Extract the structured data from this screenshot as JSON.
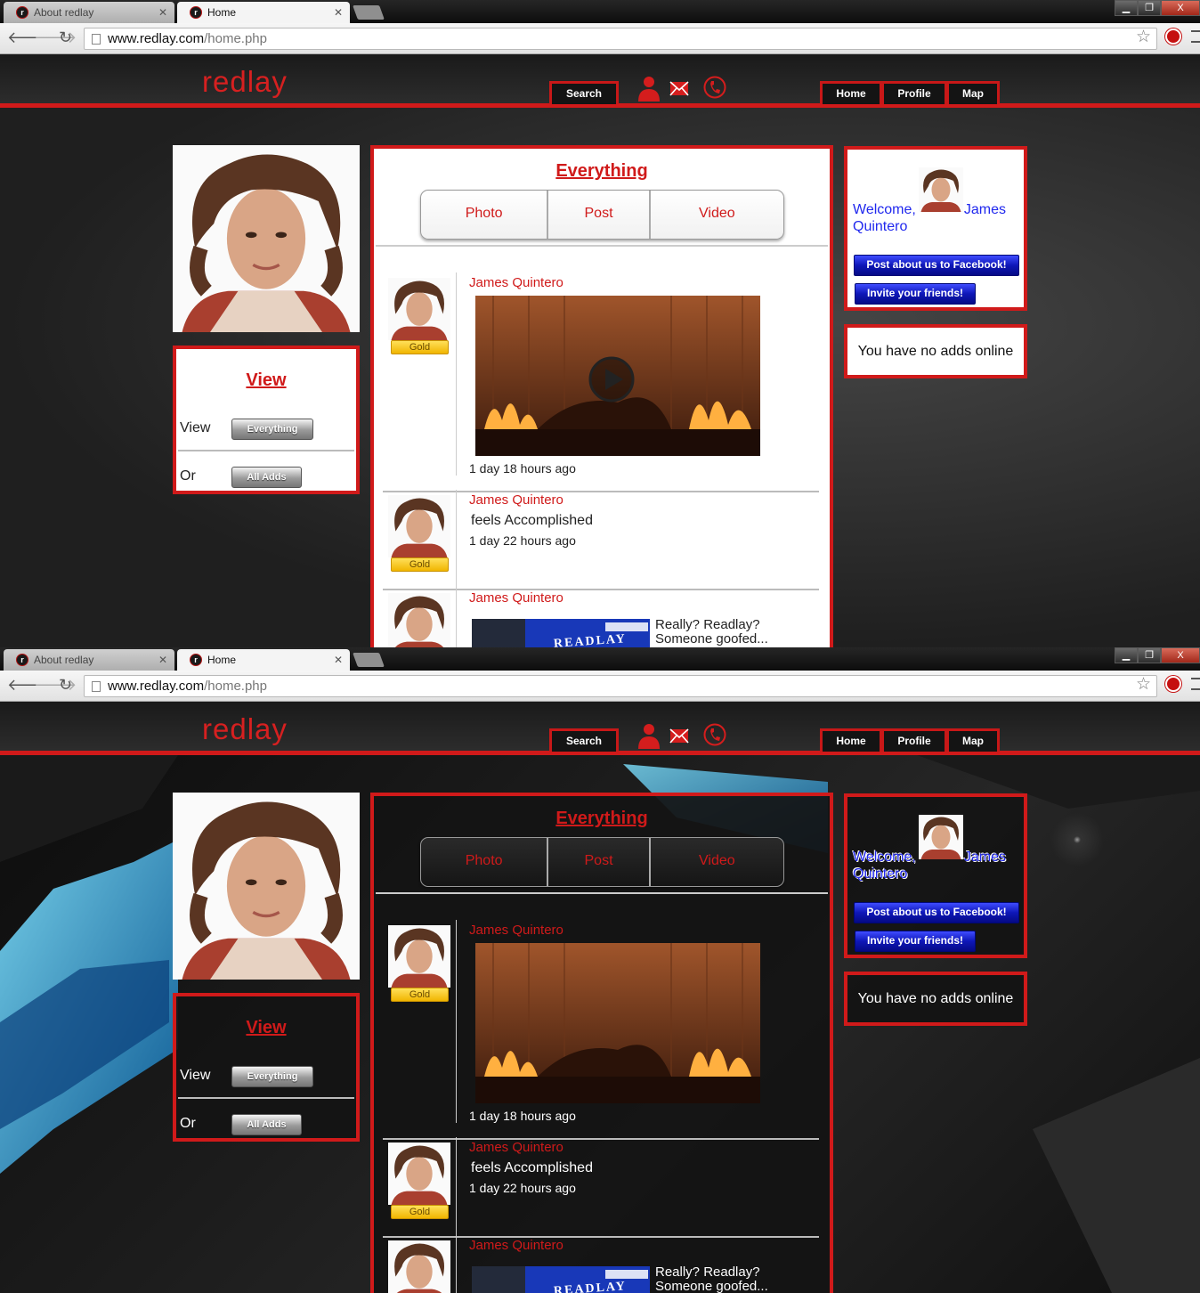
{
  "browser": {
    "tabs": [
      {
        "label": "About redlay"
      },
      {
        "label": "Home"
      }
    ],
    "url_domain": "www.redlay.com",
    "url_path": "/home.php",
    "window_close": "X"
  },
  "site": {
    "logo": "redlay",
    "search_label": "Search",
    "nav": [
      "Home",
      "Profile",
      "Map"
    ],
    "icons": [
      "person-icon",
      "mail-icon",
      "phone-icon"
    ]
  },
  "view_panel": {
    "title": "View",
    "view_label": "View",
    "view_button": "Everything",
    "or_label": "Or",
    "or_button": "All Adds"
  },
  "feed": {
    "title": "Everything",
    "filters": [
      "Photo",
      "Post",
      "Video"
    ],
    "posts": [
      {
        "author": "James Quintero",
        "badge": "Gold",
        "type": "video",
        "time": "1 day 18 hours ago"
      },
      {
        "author": "James Quintero",
        "badge": "Gold",
        "type": "status",
        "text": "feels Accomplished",
        "time": "1 day 22 hours ago"
      },
      {
        "author": "James Quintero",
        "badge": "Gold",
        "type": "link",
        "thumb_text": "READLAY",
        "text_line1": "Really? Readlay?",
        "text_line2": "Someone goofed..."
      }
    ]
  },
  "welcome": {
    "text_before": "Welcome,",
    "name_part1": "James",
    "name_part2": "Quintero",
    "facebook_button": "Post about us to Facebook!",
    "invite_button": "Invite your friends!"
  },
  "ads": {
    "message": "You have no adds online"
  },
  "colors": {
    "accent": "#d01a1a",
    "link_blue": "#2028ee",
    "gold": "#f1b500"
  }
}
